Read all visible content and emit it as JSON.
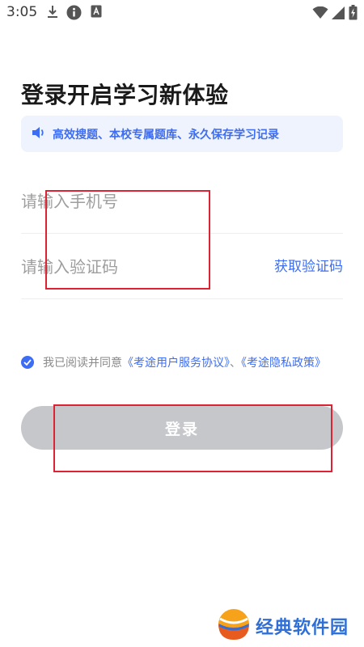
{
  "status_bar": {
    "time": "3:05",
    "icons": [
      "download-icon",
      "info-icon",
      "app-badge-icon",
      "wifi-icon",
      "signal-icon",
      "battery-charging-icon"
    ]
  },
  "title": "登录开启学习新体验",
  "notice": {
    "icon": "speaker-icon",
    "text": "高效搜题、本校专属题库、永久保存学习记录"
  },
  "phone_input": {
    "placeholder": "请输入手机号",
    "value": ""
  },
  "code_input": {
    "placeholder": "请输入验证码",
    "value": ""
  },
  "get_code_label": "获取验证码",
  "agreement": {
    "checked": true,
    "prefix": "我已阅读并同意",
    "user_agreement": "《考途用户服务协议》",
    "separator": "、",
    "privacy_policy": "《考途隐私政策》"
  },
  "login_button": "登录",
  "watermark": "经典软件园",
  "colors": {
    "accent": "#3d6df2",
    "notice_bg": "#eef3fd",
    "button_disabled": "#c6c7cb",
    "annotation_red": "#dd2233"
  }
}
